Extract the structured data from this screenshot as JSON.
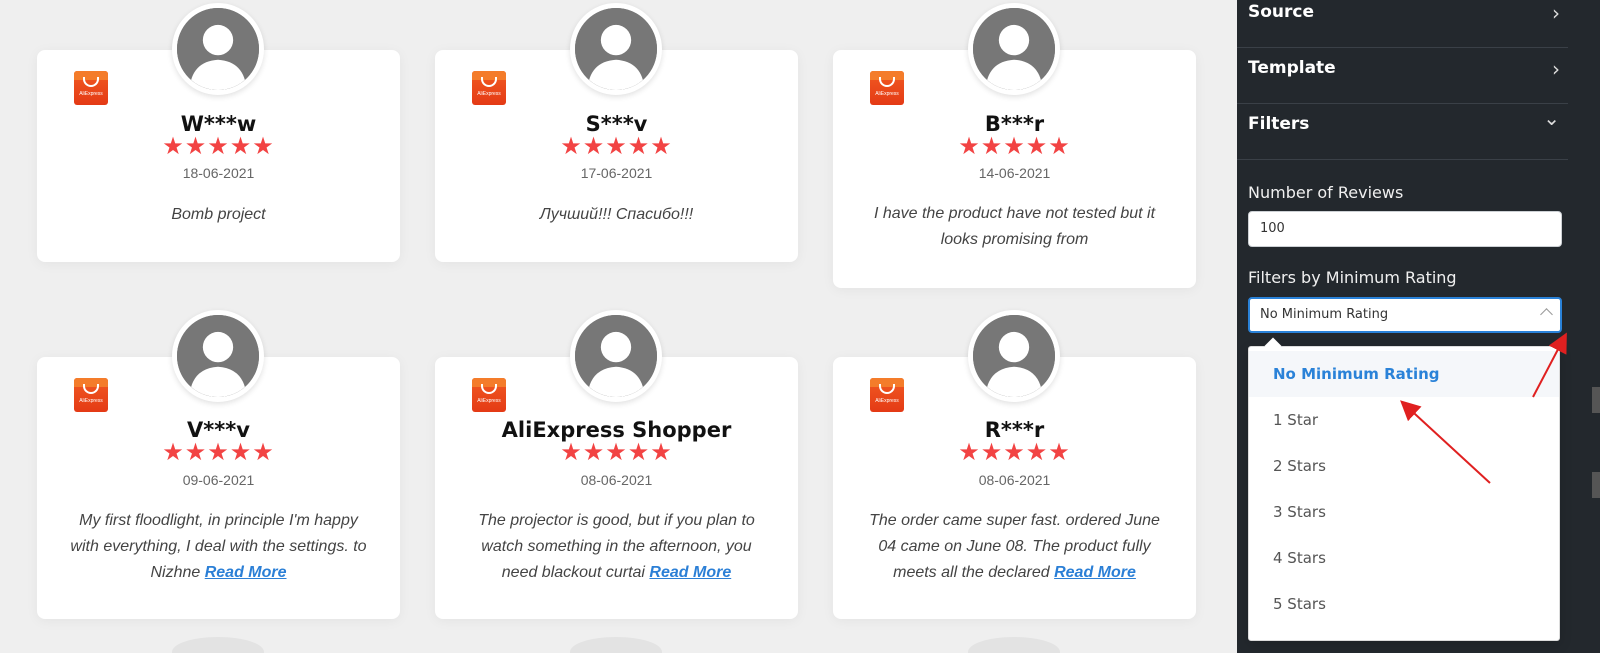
{
  "reviews": [
    {
      "logo_text": "AliExpress",
      "name": "W***w",
      "stars": "★★★★★",
      "date": "18-06-2021",
      "text": "Bomb project",
      "read_more": ""
    },
    {
      "logo_text": "AliExpress",
      "name": "S***v",
      "stars": "★★★★★",
      "date": "17-06-2021",
      "text": "Лучший!!! Спасибо!!!",
      "read_more": ""
    },
    {
      "logo_text": "AliExpress",
      "name": "B***r",
      "stars": "★★★★★",
      "date": "14-06-2021",
      "text": "I have the product have not tested but it looks promising from",
      "read_more": ""
    },
    {
      "logo_text": "AliExpress",
      "name": "V***v",
      "stars": "★★★★★",
      "date": "09-06-2021",
      "text": "My first floodlight, in principle I'm happy with everything, I deal with the settings. to Nizhne ",
      "read_more": "Read More"
    },
    {
      "logo_text": "AliExpress",
      "name": "AliExpress Shopper",
      "stars": "★★★★★",
      "date": "08-06-2021",
      "text": "The projector is good, but if you plan to watch something in the afternoon, you need blackout curtai ",
      "read_more": "Read More"
    },
    {
      "logo_text": "AliExpress",
      "name": "R***r",
      "stars": "★★★★★",
      "date": "08-06-2021",
      "text": "The order came super fast. ordered June 04 came on June 08. The product fully meets all the declared ",
      "read_more": "Read More"
    }
  ],
  "sidebar": {
    "sections": [
      {
        "label": "Source",
        "chevron": "›"
      },
      {
        "label": "Template",
        "chevron": "›"
      },
      {
        "label": "Filters",
        "chevron": "⌄"
      }
    ],
    "number_of_reviews_label": "Number of Reviews",
    "number_of_reviews_value": "100",
    "min_rating_label": "Filters by Minimum Rating",
    "min_rating_selected": "No Minimum Rating",
    "options": [
      "No Minimum Rating",
      "1 Star",
      "2 Stars",
      "3 Stars",
      "4 Stars",
      "5 Stars"
    ]
  },
  "colors": {
    "sidebar_bg": "#23282d",
    "star": "#f24343",
    "accent": "#2a82d8",
    "annotation_arrow": "#e02020"
  }
}
